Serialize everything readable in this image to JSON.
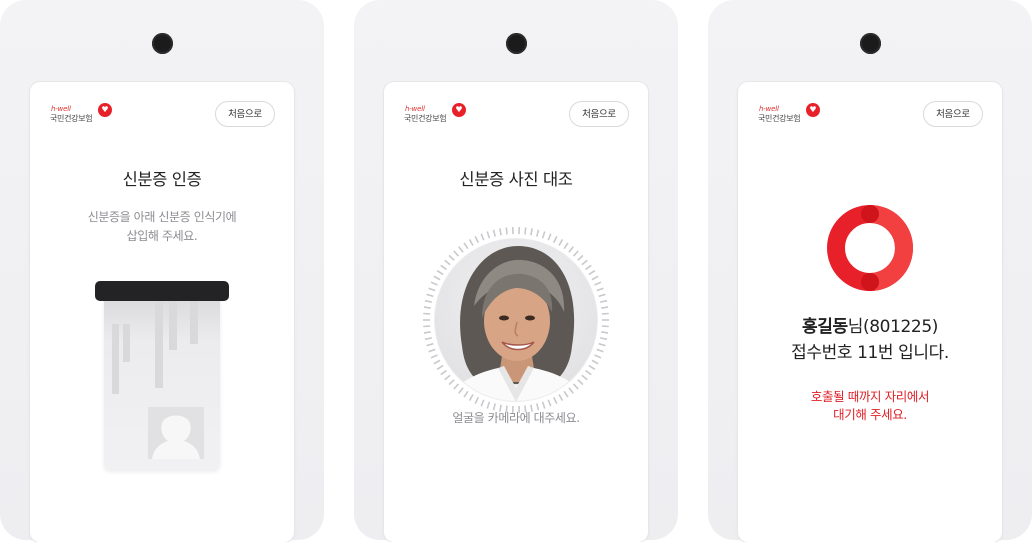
{
  "screens": [
    {
      "logo_brand": "h-well",
      "logo_org": "국민건강보험",
      "home_label": "처음으로",
      "title": "신분증 인증",
      "desc_line1": "신분증을 아래 신분증 인식기에",
      "desc_line2": "삽입해 주세요."
    },
    {
      "logo_brand": "h-well",
      "logo_org": "국민건강보험",
      "home_label": "처음으로",
      "title": "신분증 사진 대조",
      "guide": "얼굴을 카메라에 대주세요."
    },
    {
      "logo_brand": "h-well",
      "logo_org": "국민건강보험",
      "home_label": "처음으로",
      "name": "홍길동",
      "name_suffix": "님(801225)",
      "receipt": "접수번호 11번 입니다.",
      "msg_line1": "호출될 때까지 자리에서",
      "msg_line2": "대기해 주세요."
    }
  ],
  "colors": {
    "accent_red": "#e01f26",
    "device_bg": "#f0f0f3"
  }
}
